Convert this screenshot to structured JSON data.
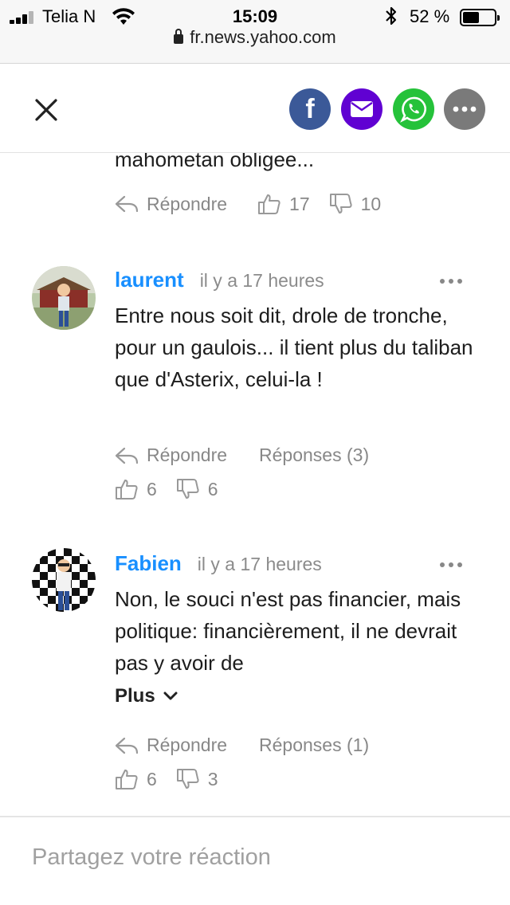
{
  "status_bar": {
    "carrier": "Telia N",
    "time": "15:09",
    "battery_percent": "52 %",
    "battery_level": 0.52,
    "url": "fr.news.yahoo.com"
  },
  "header": {
    "share_icons": [
      "close-icon",
      "facebook-icon",
      "mail-icon",
      "whatsapp-icon",
      "more-icon"
    ],
    "facebook_letter": "f",
    "colors": {
      "facebook": "#3b5998",
      "mail": "#6001d2",
      "whatsapp": "#25c23a",
      "more": "#7a7a7a",
      "author": "#188fff"
    }
  },
  "previous_comment": {
    "text_tail": "mahometan obligee...",
    "reply_label": "Répondre",
    "likes": "17",
    "dislikes": "10"
  },
  "comments": [
    {
      "author": "laurent",
      "time": "il y a 17 heures",
      "text": "Entre nous soit dit, drole de tronche, pour un gaulois... il tient plus du taliban que d'Asterix, celui-la !",
      "reply_label": "Répondre",
      "replies_label": "Réponses (3)",
      "likes": "6",
      "dislikes": "6"
    },
    {
      "author": "Fabien",
      "time": "il y a 17 heures",
      "text": "Non, le souci n'est pas financier, mais politique: financièrement, il ne devrait pas y avoir de",
      "more_label": "Plus",
      "reply_label": "Répondre",
      "replies_label": "Réponses (1)",
      "likes": "6",
      "dislikes": "3"
    }
  ],
  "footer": {
    "placeholder": "Partagez votre réaction"
  }
}
